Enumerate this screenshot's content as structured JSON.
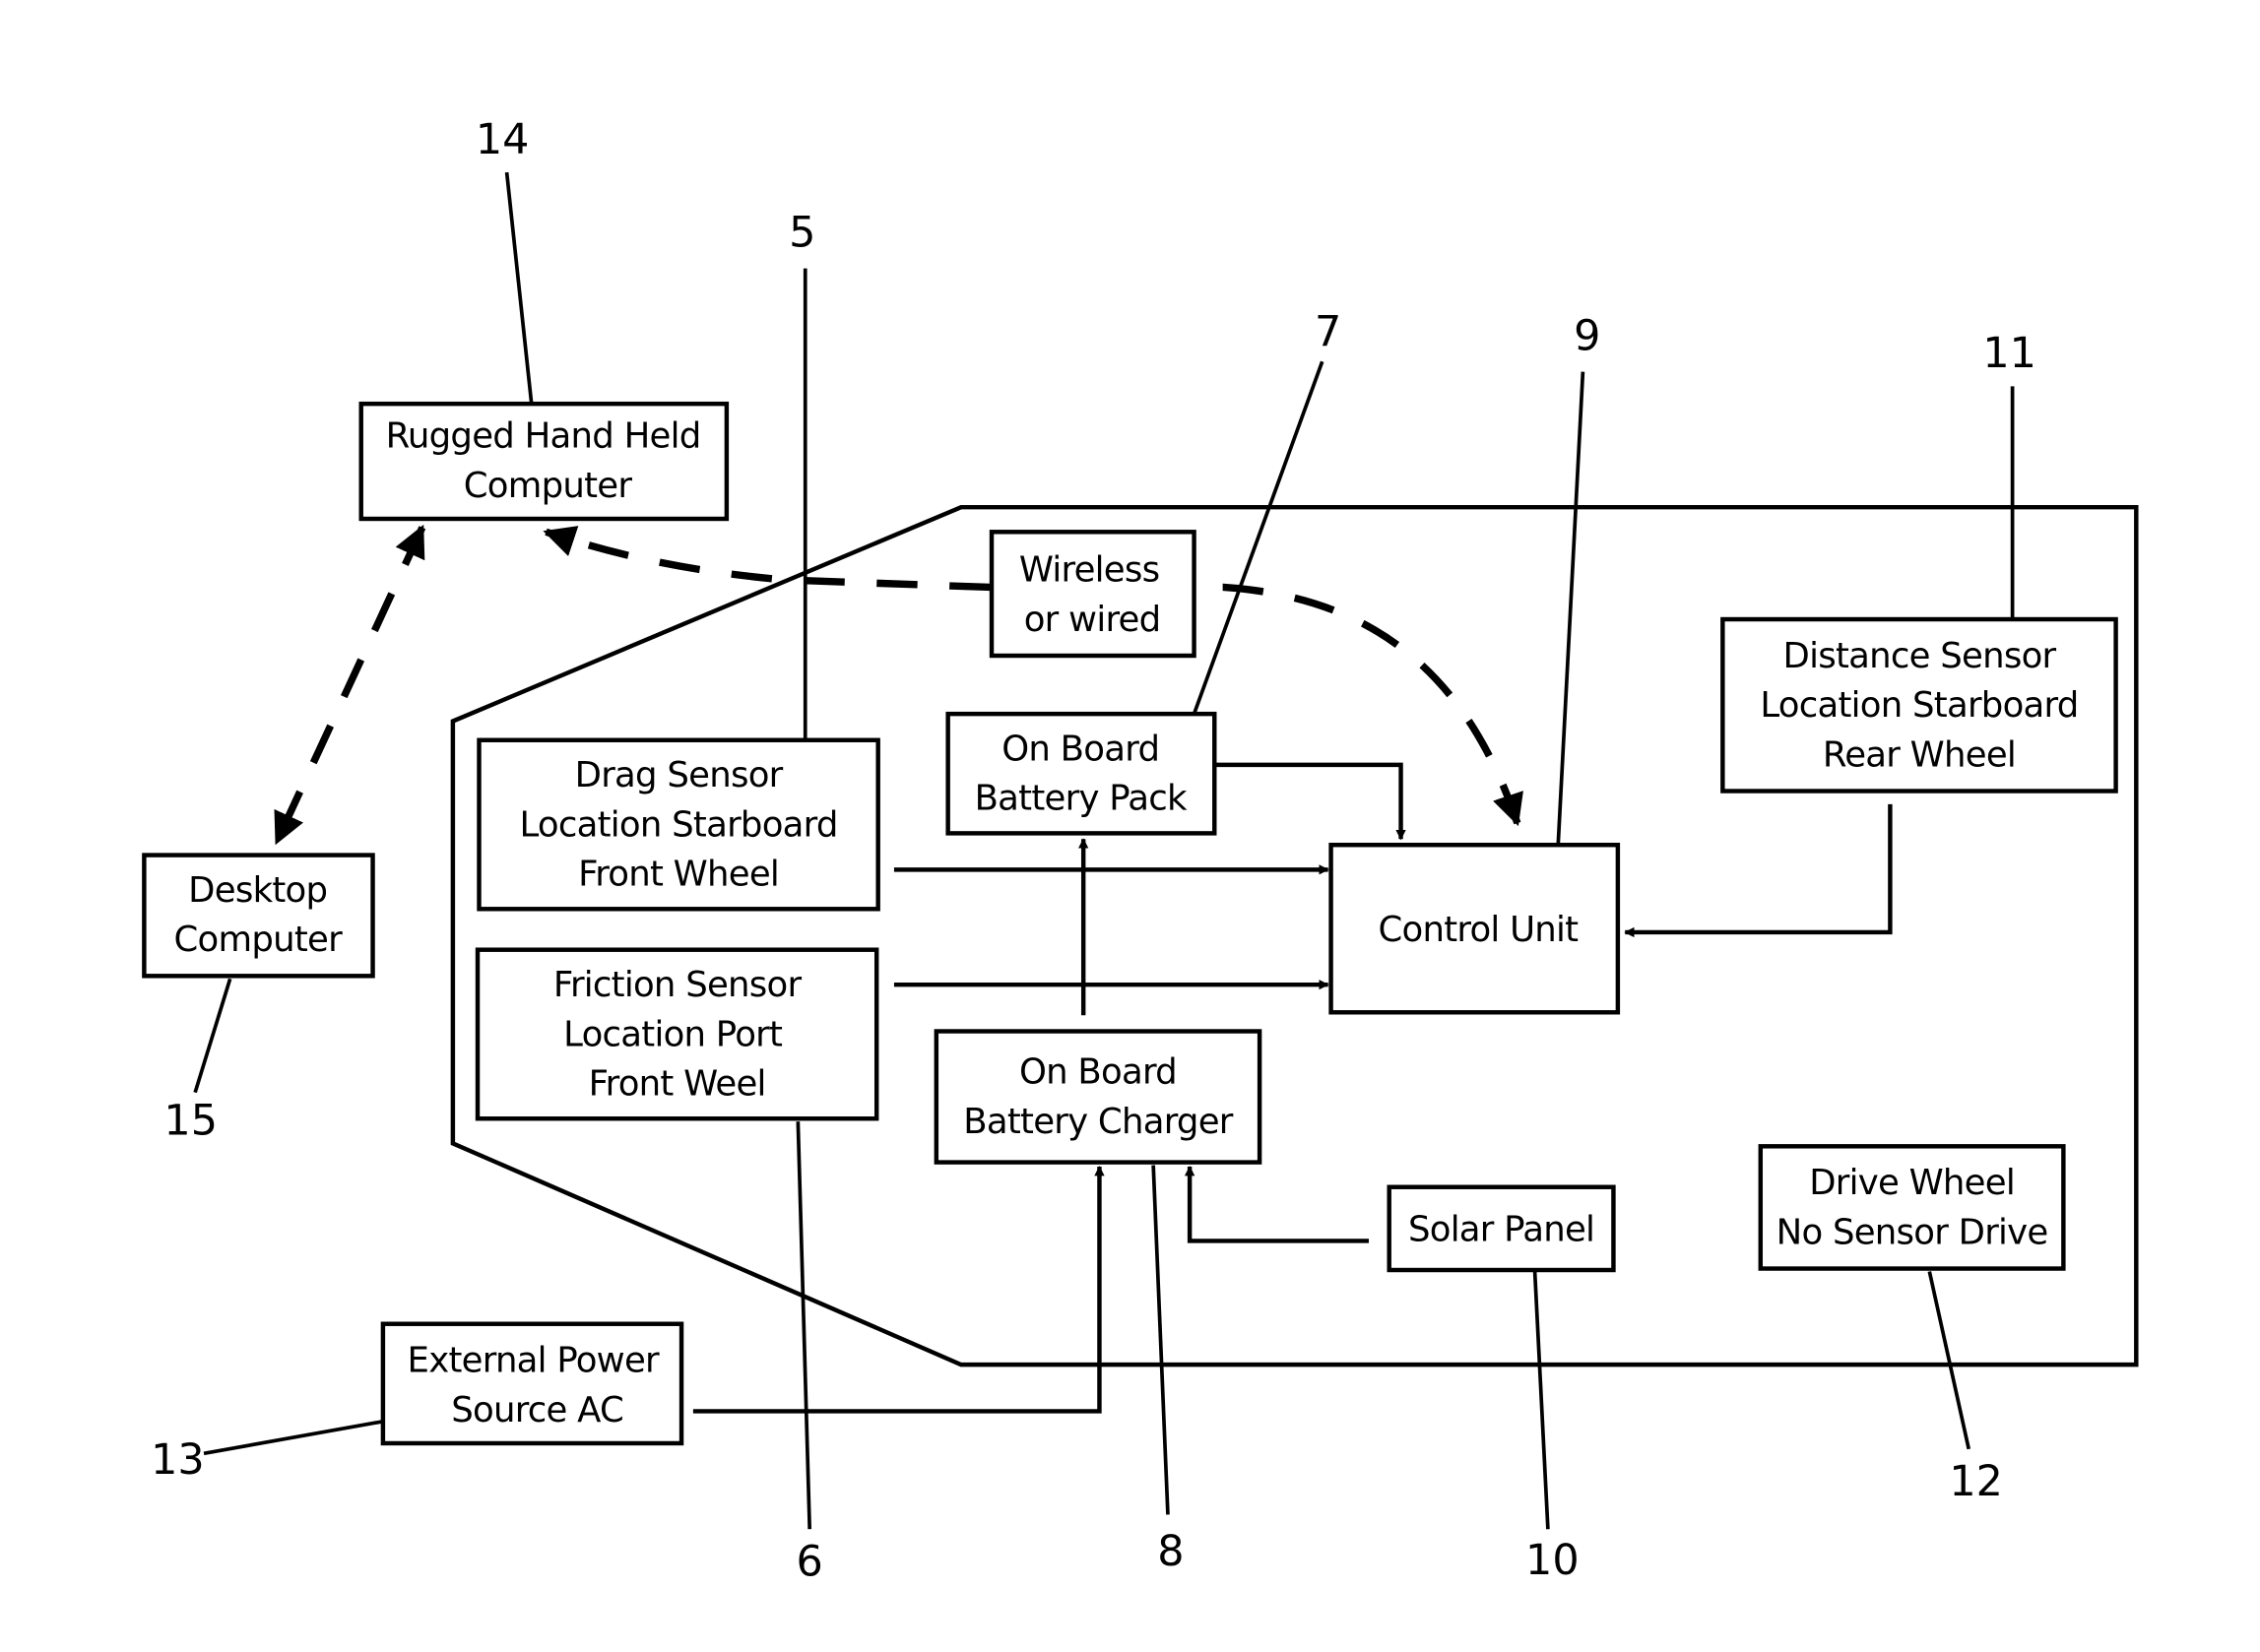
{
  "diagram": {
    "blocks": {
      "rugged_handheld": {
        "lines": [
          "Rugged Hand Held",
          "Computer"
        ],
        "ref": "14"
      },
      "desktop": {
        "lines": [
          "Desktop",
          "Computer"
        ],
        "ref": "15"
      },
      "wireless": {
        "lines": [
          "Wireless",
          "or wired"
        ]
      },
      "drag_sensor": {
        "lines": [
          "Drag Sensor",
          "Location Starboard",
          "Front Wheel"
        ],
        "ref": "5"
      },
      "friction_sensor": {
        "lines": [
          "Friction Sensor",
          "Location Port",
          "Front Weel"
        ],
        "ref": "6"
      },
      "battery_pack": {
        "lines": [
          "On Board",
          "Battery Pack"
        ],
        "ref": "7"
      },
      "battery_charger": {
        "lines": [
          "On Board",
          "Battery Charger"
        ],
        "ref": "8"
      },
      "control_unit": {
        "lines": [
          "Control Unit"
        ],
        "ref": "9"
      },
      "solar_panel": {
        "lines": [
          "Solar Panel"
        ],
        "ref": "10"
      },
      "distance_sensor": {
        "lines": [
          "Distance Sensor",
          "Location Starboard",
          "Rear Wheel"
        ],
        "ref": "11"
      },
      "drive_wheel": {
        "lines": [
          "Drive Wheel",
          "No Sensor Drive"
        ],
        "ref": "12"
      },
      "external_power": {
        "lines": [
          "External Power",
          "Source AC"
        ],
        "ref": "13"
      }
    },
    "connections": [
      {
        "from": "drag_sensor",
        "to": "control_unit",
        "style": "solid-arrow"
      },
      {
        "from": "friction_sensor",
        "to": "control_unit",
        "style": "solid-arrow"
      },
      {
        "from": "battery_pack",
        "to": "control_unit",
        "style": "solid-arrow"
      },
      {
        "from": "battery_charger",
        "to": "battery_pack",
        "style": "solid-arrow"
      },
      {
        "from": "distance_sensor",
        "to": "control_unit",
        "style": "solid-arrow"
      },
      {
        "from": "solar_panel",
        "to": "battery_charger",
        "style": "solid-arrow"
      },
      {
        "from": "external_power",
        "to": "battery_charger",
        "style": "solid-arrow"
      },
      {
        "from": "control_unit",
        "to": "rugged_handheld",
        "style": "dashed-bidirectional",
        "via": "wireless"
      },
      {
        "from": "rugged_handheld",
        "to": "desktop",
        "style": "dashed-bidirectional"
      }
    ]
  }
}
